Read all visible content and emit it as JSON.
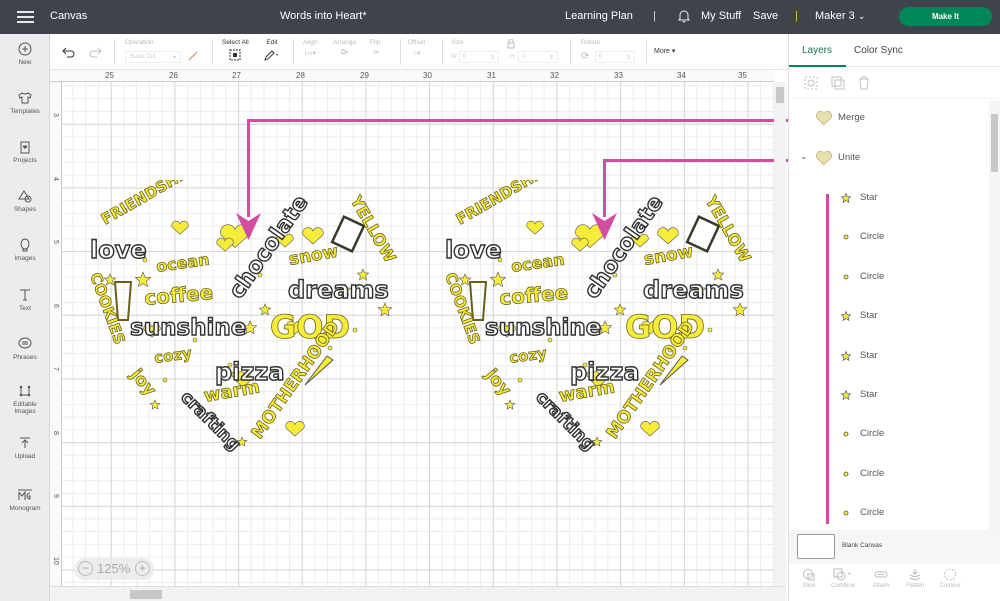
{
  "topbar": {
    "app_label": "Canvas",
    "doc_title": "Words into Heart*",
    "learning_plan": "Learning Plan",
    "separator": "|",
    "my_stuff": "My Stuff",
    "save": "Save",
    "machine": "Maker 3",
    "make_it": "Make It",
    "accent_color": "#008658"
  },
  "sidebar": {
    "items": [
      {
        "label": "New",
        "icon": "plus-circle-icon"
      },
      {
        "label": "Templates",
        "icon": "tshirt-icon"
      },
      {
        "label": "Projects",
        "icon": "clipboard-heart-icon"
      },
      {
        "label": "Shapes",
        "icon": "shapes-icon"
      },
      {
        "label": "Images",
        "icon": "lightbulb-balloon-icon"
      },
      {
        "label": "Text",
        "icon": "text-t-icon"
      },
      {
        "label": "Phrases",
        "icon": "speech-bubble-icon"
      },
      {
        "label": "Editable",
        "label2": "Images",
        "icon": "editable-image-icon"
      },
      {
        "label": "Upload",
        "icon": "upload-icon"
      },
      {
        "label": "Monogram",
        "icon": "monogram-icon"
      }
    ]
  },
  "toolbar": {
    "operation_label": "Operation",
    "operation_value": "Basic Cut",
    "select_all": "Select All",
    "edit": "Edit",
    "align": "Align",
    "arrange": "Arrange",
    "flip": "Flip",
    "offset": "Offset",
    "size": "Size",
    "w_label": "W",
    "h_label": "H",
    "w_value": "0",
    "h_value": "0",
    "rotate": "Rotate",
    "rotate_value": "0",
    "more": "More ▾"
  },
  "rulers": {
    "top": [
      "25",
      "26",
      "27",
      "28",
      "29",
      "30",
      "31",
      "32",
      "33",
      "34",
      "35"
    ],
    "left": [
      "3",
      "4",
      "5",
      "6",
      "7",
      "8",
      "9",
      "10"
    ]
  },
  "canvas": {
    "zoom_level": "125%",
    "zoom_out": "−",
    "zoom_in": "+",
    "artwork_words": [
      "FRIENDSHIP",
      "love",
      "ocean",
      "chocolate",
      "YELLOW",
      "snow",
      "dreams",
      "COOKIES",
      "coffee",
      "sunshine",
      "GOD",
      "cozy",
      "joy",
      "pizza",
      "warm",
      "crafting",
      "MOTHERHOOD"
    ],
    "annotation_color": "#d24ca1",
    "art_yellow": "#f7ec3a",
    "art_dark": "#2f2f2f"
  },
  "panel": {
    "tabs": [
      {
        "label": "Layers",
        "active": true
      },
      {
        "label": "Color Sync",
        "active": false
      }
    ],
    "layers": [
      {
        "name": "Merge",
        "type": "group-heart",
        "expanded": false
      },
      {
        "name": "Unite",
        "type": "group-heart",
        "expanded": true
      },
      {
        "name": "Star",
        "type": "star"
      },
      {
        "name": "Circle",
        "type": "circle"
      },
      {
        "name": "Circle",
        "type": "circle"
      },
      {
        "name": "Star",
        "type": "star"
      },
      {
        "name": "Star",
        "type": "star"
      },
      {
        "name": "Star",
        "type": "star"
      },
      {
        "name": "Circle",
        "type": "circle"
      },
      {
        "name": "Circle",
        "type": "circle"
      },
      {
        "name": "Circle",
        "type": "circle"
      }
    ],
    "blank_canvas": "Blank Canvas",
    "bottom_tools": [
      "Slice",
      "Combine",
      "Attach",
      "Flatten",
      "Contour"
    ]
  }
}
